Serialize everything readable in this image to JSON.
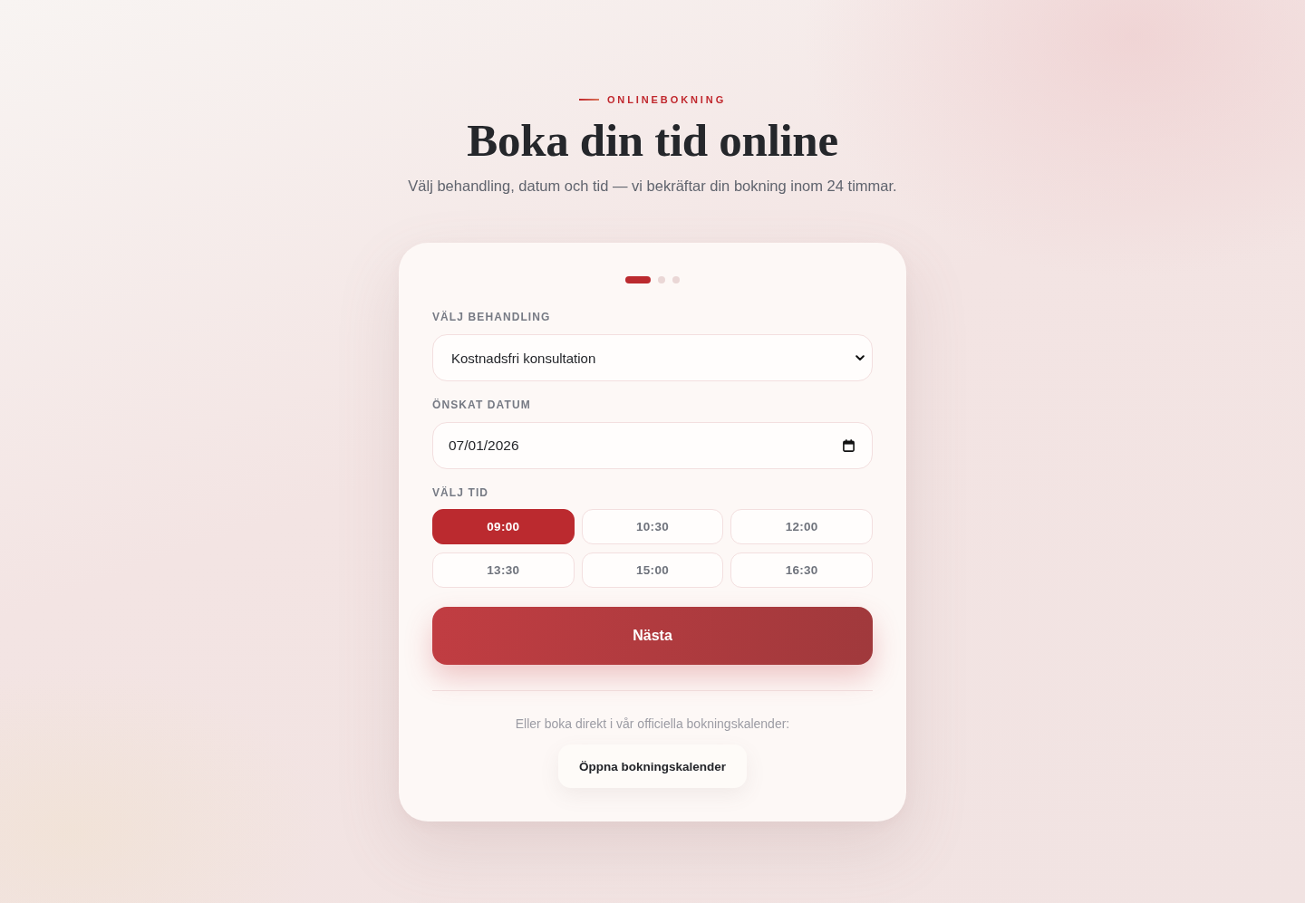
{
  "header": {
    "eyebrow": "ONLINEBOKNING",
    "title": "Boka din tid online",
    "subtitle": "Välj behandling, datum och tid — vi bekräftar din bokning inom 24 timmar."
  },
  "steps": [
    {
      "selected": true
    },
    {
      "selected": false
    },
    {
      "selected": false
    }
  ],
  "form": {
    "treatment": {
      "label": "VÄLJ BEHANDLING",
      "value": "Kostnadsfri konsultation"
    },
    "date": {
      "label": "ÖNSKAT DATUM",
      "value": "07/01/2026"
    },
    "time": {
      "label": "VÄLJ TID",
      "slots": [
        {
          "label": "09:00",
          "selected": true
        },
        {
          "label": "10:30",
          "selected": false
        },
        {
          "label": "12:00",
          "selected": false
        },
        {
          "label": "13:30",
          "selected": false
        },
        {
          "label": "15:00",
          "selected": false
        },
        {
          "label": "16:30",
          "selected": false
        }
      ]
    },
    "next_button": "Nästa"
  },
  "alternative": {
    "text": "Eller boka direkt i vår officiella bokningskalender:",
    "button": "Öppna bokningskalender"
  }
}
